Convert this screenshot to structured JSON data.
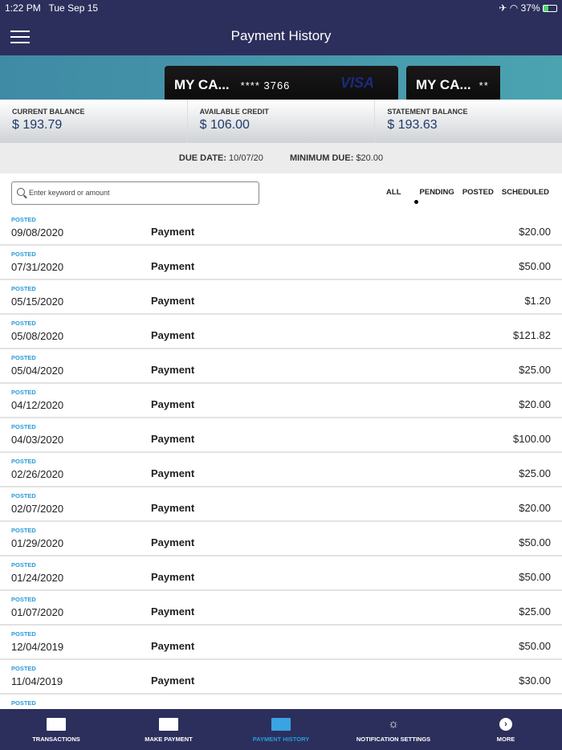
{
  "status": {
    "time": "1:22 PM",
    "date": "Tue Sep 15",
    "battery": "37%",
    "icons": [
      "airplane-icon",
      "wifi-icon",
      "battery-icon"
    ]
  },
  "header": {
    "title": "Payment History"
  },
  "cards": [
    {
      "name": "MY CA...",
      "number": "**** 3766",
      "brand": "VISA"
    },
    {
      "name": "MY CA...",
      "number": "**"
    }
  ],
  "balances": [
    {
      "label": "CURRENT BALANCE",
      "value": "$ 193.79"
    },
    {
      "label": "AVAILABLE CREDIT",
      "value": "$ 106.00"
    },
    {
      "label": "STATEMENT BALANCE",
      "value": "$ 193.63"
    }
  ],
  "due": {
    "due_label": "DUE DATE:",
    "due_value": "10/07/20",
    "min_label": "MINIMUM DUE:",
    "min_value": "$20.00"
  },
  "search": {
    "placeholder": "Enter keyword or amount"
  },
  "filters": [
    "ALL",
    "PENDING",
    "POSTED",
    "SCHEDULED"
  ],
  "transactions": [
    {
      "status": "POSTED",
      "date": "09/08/2020",
      "desc": "Payment",
      "amount": "$20.00"
    },
    {
      "status": "POSTED",
      "date": "07/31/2020",
      "desc": "Payment",
      "amount": "$50.00"
    },
    {
      "status": "POSTED",
      "date": "05/15/2020",
      "desc": "Payment",
      "amount": "$1.20"
    },
    {
      "status": "POSTED",
      "date": "05/08/2020",
      "desc": "Payment",
      "amount": "$121.82"
    },
    {
      "status": "POSTED",
      "date": "05/04/2020",
      "desc": "Payment",
      "amount": "$25.00"
    },
    {
      "status": "POSTED",
      "date": "04/12/2020",
      "desc": "Payment",
      "amount": "$20.00"
    },
    {
      "status": "POSTED",
      "date": "04/03/2020",
      "desc": "Payment",
      "amount": "$100.00"
    },
    {
      "status": "POSTED",
      "date": "02/26/2020",
      "desc": "Payment",
      "amount": "$25.00"
    },
    {
      "status": "POSTED",
      "date": "02/07/2020",
      "desc": "Payment",
      "amount": "$20.00"
    },
    {
      "status": "POSTED",
      "date": "01/29/2020",
      "desc": "Payment",
      "amount": "$50.00"
    },
    {
      "status": "POSTED",
      "date": "01/24/2020",
      "desc": "Payment",
      "amount": "$50.00"
    },
    {
      "status": "POSTED",
      "date": "01/07/2020",
      "desc": "Payment",
      "amount": "$25.00"
    },
    {
      "status": "POSTED",
      "date": "12/04/2019",
      "desc": "Payment",
      "amount": "$50.00"
    },
    {
      "status": "POSTED",
      "date": "11/04/2019",
      "desc": "Payment",
      "amount": "$30.00"
    },
    {
      "status": "POSTED"
    }
  ],
  "nav": [
    {
      "label": "TRANSACTIONS"
    },
    {
      "label": "MAKE PAYMENT"
    },
    {
      "label": "PAYMENT HISTORY"
    },
    {
      "label": "NOTIFICATION SETTINGS"
    },
    {
      "label": "MORE"
    }
  ]
}
